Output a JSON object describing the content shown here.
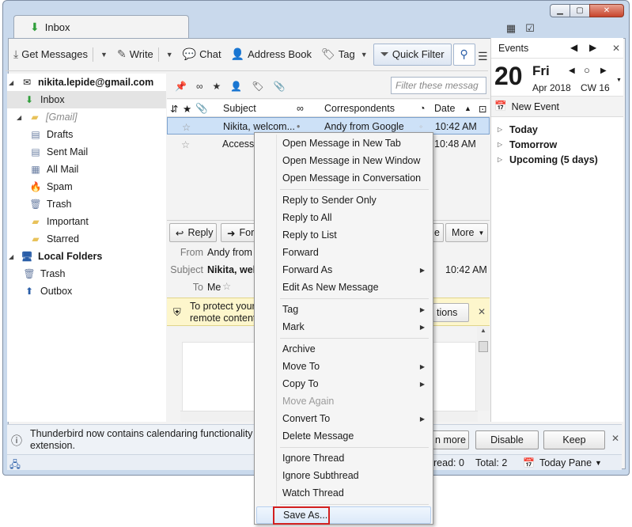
{
  "window": {
    "tab_title": "Inbox",
    "caption_min": "▁",
    "caption_max": "▢",
    "caption_close": "✕"
  },
  "toolbar": {
    "get_messages": "Get Messages",
    "write": "Write",
    "chat": "Chat",
    "address_book": "Address Book",
    "tag": "Tag",
    "quick_filter": "Quick Filter"
  },
  "folders": {
    "account": "nikita.lepide@gmail.com",
    "inbox": "Inbox",
    "gmail": "[Gmail]",
    "drafts": "Drafts",
    "sent": "Sent Mail",
    "all": "All Mail",
    "spam": "Spam",
    "trash": "Trash",
    "important": "Important",
    "starred": "Starred",
    "local": "Local Folders",
    "local_trash": "Trash",
    "outbox": "Outbox"
  },
  "thread": {
    "filter_placeholder": "Filter these messag",
    "col_subject": "Subject",
    "col_correspondents": "Correspondents",
    "col_date": "Date",
    "rows": [
      {
        "subject": "Nikita, welcom...",
        "from": "Andy from Google",
        "date": "10:42 AM"
      },
      {
        "subject": "Access",
        "from": "",
        "date": "10:48 AM"
      }
    ]
  },
  "message": {
    "reply": "Reply",
    "forward_partial": "For",
    "archive_partial": "e",
    "more": "More",
    "from_label": "From",
    "from_value": "Andy from",
    "subject_label": "Subject",
    "subject_value": "Nikita, wel",
    "to_label": "To",
    "to_value": "Me",
    "time": "10:42 AM",
    "warn_line1": "To protect your",
    "warn_line2": "remote content",
    "options_partial": "tions"
  },
  "events": {
    "title": "Events",
    "day": "20",
    "weekday": "Fri",
    "month_year": "Apr 2018",
    "cw": "CW 16",
    "new_event": "New Event",
    "today": "Today",
    "tomorrow": "Tomorrow",
    "upcoming": "Upcoming (5 days)"
  },
  "notification": {
    "line1": "Thunderbird now contains calendaring functionality b",
    "line2": "extension.",
    "learn_more": "n more",
    "disable": "Disable",
    "keep": "Keep"
  },
  "status": {
    "unread": "read: 0",
    "total": "Total: 2",
    "today_pane": "Today Pane"
  },
  "context_menu": {
    "open_new_tab": "Open Message in New Tab",
    "open_new_window": "Open Message in New Window",
    "open_conversation": "Open Message in Conversation",
    "reply_sender": "Reply to Sender Only",
    "reply_all": "Reply to All",
    "reply_list": "Reply to List",
    "forward": "Forward",
    "forward_as": "Forward As",
    "edit_new": "Edit As New Message",
    "tag": "Tag",
    "mark": "Mark",
    "archive": "Archive",
    "move_to": "Move To",
    "copy_to": "Copy To",
    "move_again": "Move Again",
    "convert_to": "Convert To",
    "delete": "Delete Message",
    "ignore_thread": "Ignore Thread",
    "ignore_subthread": "Ignore Subthread",
    "watch_thread": "Watch Thread",
    "save_as": "Save As..."
  },
  "colors": {
    "selection": "#cde1f7",
    "highlight_box": "#d21f1f",
    "warning_bg": "#fdf6cc",
    "frame": "#c9d9ec"
  }
}
